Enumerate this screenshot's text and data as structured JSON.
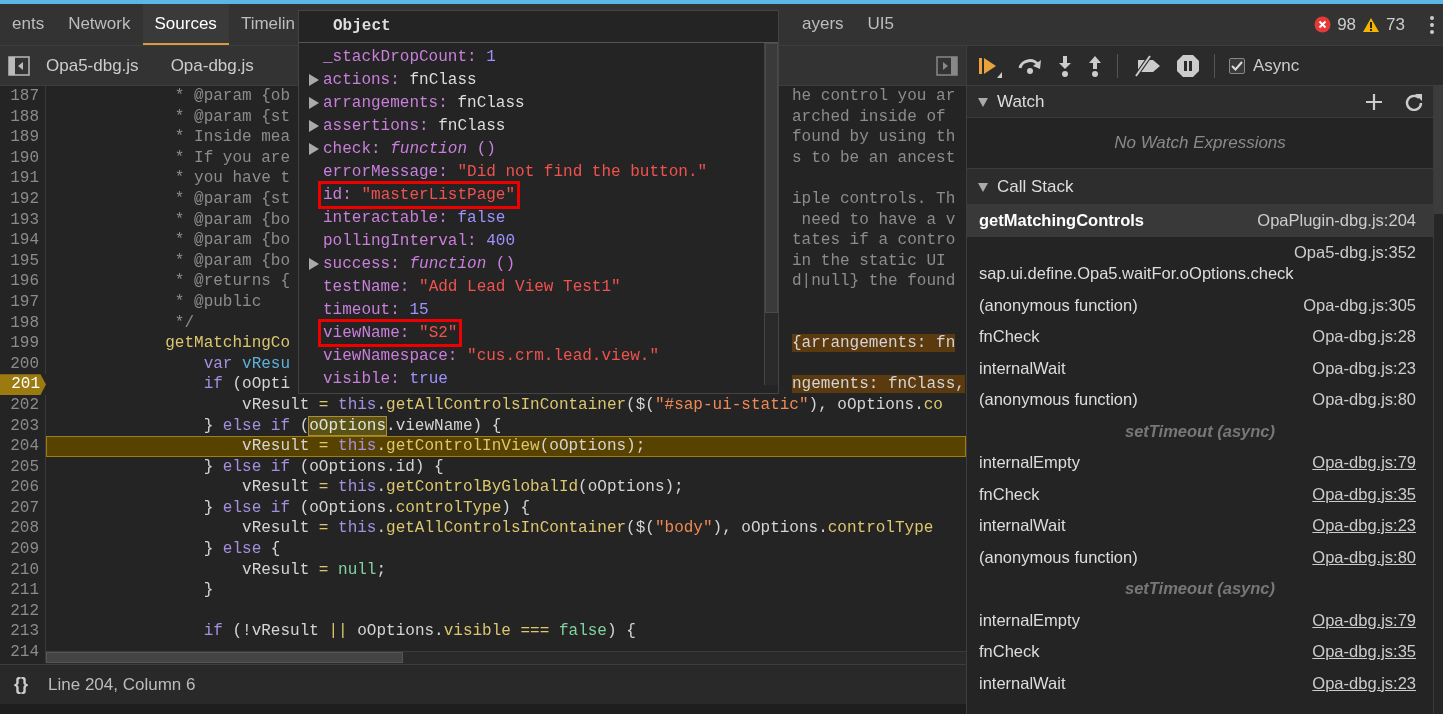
{
  "tabs": [
    {
      "label": "ents",
      "selected": false
    },
    {
      "label": "Network",
      "selected": false
    },
    {
      "label": "Sources",
      "selected": true
    },
    {
      "label": "Timelin",
      "selected": false
    }
  ],
  "tabs_beyond_popover": [
    {
      "label": "ayers",
      "selected": false
    },
    {
      "label": "UI5",
      "selected": false
    }
  ],
  "counters": {
    "errors": "98",
    "warnings": "73"
  },
  "file_tabs": [
    "Opa5-dbg.js",
    "Opa-dbg.js"
  ],
  "editor": {
    "lines": [
      {
        "number": "187",
        "breakpoint": false,
        "current": false,
        "left": [
          {
            "text": "             * @param {ob",
            "kind": "comment"
          }
        ],
        "right": [
          {
            "text": "he control you ar",
            "kind": "comment"
          }
        ]
      },
      {
        "number": "188",
        "breakpoint": false,
        "current": false,
        "left": [
          {
            "text": "             * @param {st",
            "kind": "comment"
          }
        ],
        "right": [
          {
            "text": "arched inside of",
            "kind": "comment"
          }
        ]
      },
      {
        "number": "189",
        "breakpoint": false,
        "current": false,
        "left": [
          {
            "text": "             * Inside mea",
            "kind": "comment"
          }
        ],
        "right": [
          {
            "text": "found by using th",
            "kind": "comment"
          }
        ]
      },
      {
        "number": "190",
        "breakpoint": false,
        "current": false,
        "left": [
          {
            "text": "             * If you are",
            "kind": "comment"
          }
        ],
        "right": [
          {
            "text": "s to be an ancest",
            "kind": "comment"
          }
        ]
      },
      {
        "number": "191",
        "breakpoint": false,
        "current": false,
        "left": [
          {
            "text": "             * you have t",
            "kind": "comment"
          }
        ]
      },
      {
        "number": "192",
        "breakpoint": false,
        "current": false,
        "left": [
          {
            "text": "             * @param {st",
            "kind": "comment"
          }
        ],
        "right": [
          {
            "text": "iple controls. Th",
            "kind": "comment"
          }
        ]
      },
      {
        "number": "193",
        "breakpoint": false,
        "current": false,
        "left": [
          {
            "text": "             * @param {bo",
            "kind": "comment"
          }
        ],
        "right": [
          {
            "text": " need to have a v",
            "kind": "comment"
          }
        ]
      },
      {
        "number": "194",
        "breakpoint": false,
        "current": false,
        "left": [
          {
            "text": "             * @param {bo",
            "kind": "comment"
          }
        ],
        "right": [
          {
            "text": "tates if a contro",
            "kind": "comment"
          }
        ]
      },
      {
        "number": "195",
        "breakpoint": false,
        "current": false,
        "left": [
          {
            "text": "             * @param {bo",
            "kind": "comment"
          }
        ],
        "right": [
          {
            "text": "in the static UI",
            "kind": "comment"
          }
        ]
      },
      {
        "number": "196",
        "breakpoint": false,
        "current": false,
        "left": [
          {
            "text": "             * @returns {",
            "kind": "comment"
          }
        ],
        "right": [
          {
            "text": "d|null} the found",
            "kind": "comment"
          }
        ]
      },
      {
        "number": "197",
        "breakpoint": false,
        "current": false,
        "left": [
          {
            "text": "             * @public",
            "kind": "comment"
          }
        ]
      },
      {
        "number": "198",
        "breakpoint": false,
        "current": false,
        "left": [
          {
            "text": "             */",
            "kind": "comment"
          }
        ]
      },
      {
        "number": "199",
        "breakpoint": false,
        "current": false,
        "left": [
          {
            "text": "            getMatchingCo",
            "kind": "method"
          }
        ],
        "right": [
          {
            "text": "{arrangements: fn",
            "kind": "inline_value"
          }
        ]
      },
      {
        "number": "200",
        "breakpoint": false,
        "current": false,
        "left": [
          {
            "text": "                var ",
            "kind": "keyword"
          },
          {
            "text": "vResu",
            "kind": "variable"
          }
        ]
      },
      {
        "number": "201",
        "breakpoint": true,
        "current": false,
        "left": [
          {
            "text": "                if",
            "kind": "keyword"
          },
          {
            "text": " (oOpti",
            "kind": "plain"
          }
        ],
        "right": [
          {
            "text": "ngements: fnClass,",
            "kind": "inline_value"
          }
        ]
      },
      {
        "number": "202",
        "breakpoint": false,
        "current": false,
        "left": [
          {
            "text": "                    vResult ",
            "kind": "plain"
          },
          {
            "text": "= ",
            "kind": "operator"
          },
          {
            "text": "this",
            "kind": "keyword"
          },
          {
            "text": ".",
            "kind": "plain"
          },
          {
            "text": "getAllControlsInContainer",
            "kind": "method"
          },
          {
            "text": "($(",
            "kind": "plain"
          },
          {
            "text": "\"#sap-ui-static\"",
            "kind": "string"
          },
          {
            "text": "), oOptions.",
            "kind": "plain"
          },
          {
            "text": "co",
            "kind": "method"
          }
        ]
      },
      {
        "number": "203",
        "breakpoint": false,
        "current": false,
        "left": [
          {
            "text": "                } ",
            "kind": "plain"
          },
          {
            "text": "else if",
            "kind": "keyword"
          },
          {
            "text": " (",
            "kind": "plain"
          },
          {
            "text": "oOptions",
            "kind": "hover"
          },
          {
            "text": ".viewName) {",
            "kind": "plain"
          }
        ]
      },
      {
        "number": "204",
        "breakpoint": false,
        "current": true,
        "left": [
          {
            "text": "                    vResult ",
            "kind": "plain"
          },
          {
            "text": "= ",
            "kind": "operator"
          },
          {
            "text": "this",
            "kind": "keyword"
          },
          {
            "text": ".",
            "kind": "plain"
          },
          {
            "text": "getControlInView",
            "kind": "method"
          },
          {
            "text": "(oOptions);",
            "kind": "plain"
          }
        ]
      },
      {
        "number": "205",
        "breakpoint": false,
        "current": false,
        "left": [
          {
            "text": "                } ",
            "kind": "plain"
          },
          {
            "text": "else if",
            "kind": "keyword"
          },
          {
            "text": " (oOptions.id) {",
            "kind": "plain"
          }
        ]
      },
      {
        "number": "206",
        "breakpoint": false,
        "current": false,
        "left": [
          {
            "text": "                    vResult ",
            "kind": "plain"
          },
          {
            "text": "= ",
            "kind": "operator"
          },
          {
            "text": "this",
            "kind": "keyword"
          },
          {
            "text": ".",
            "kind": "plain"
          },
          {
            "text": "getControlByGlobalId",
            "kind": "method"
          },
          {
            "text": "(oOptions);",
            "kind": "plain"
          }
        ]
      },
      {
        "number": "207",
        "breakpoint": false,
        "current": false,
        "left": [
          {
            "text": "                } ",
            "kind": "plain"
          },
          {
            "text": "else if",
            "kind": "keyword"
          },
          {
            "text": " (oOptions.",
            "kind": "plain"
          },
          {
            "text": "controlType",
            "kind": "method"
          },
          {
            "text": ") {",
            "kind": "plain"
          }
        ]
      },
      {
        "number": "208",
        "breakpoint": false,
        "current": false,
        "left": [
          {
            "text": "                    vResult ",
            "kind": "plain"
          },
          {
            "text": "= ",
            "kind": "operator"
          },
          {
            "text": "this",
            "kind": "keyword"
          },
          {
            "text": ".",
            "kind": "plain"
          },
          {
            "text": "getAllControlsInContainer",
            "kind": "method"
          },
          {
            "text": "($(",
            "kind": "plain"
          },
          {
            "text": "\"body\"",
            "kind": "string"
          },
          {
            "text": "), oOptions.",
            "kind": "plain"
          },
          {
            "text": "controlType",
            "kind": "method"
          }
        ]
      },
      {
        "number": "209",
        "breakpoint": false,
        "current": false,
        "left": [
          {
            "text": "                } ",
            "kind": "plain"
          },
          {
            "text": "else",
            "kind": "keyword"
          },
          {
            "text": " {",
            "kind": "plain"
          }
        ]
      },
      {
        "number": "210",
        "breakpoint": false,
        "current": false,
        "left": [
          {
            "text": "                    vResult ",
            "kind": "plain"
          },
          {
            "text": "= ",
            "kind": "operator"
          },
          {
            "text": "null",
            "kind": "literal"
          },
          {
            "text": ";",
            "kind": "plain"
          }
        ]
      },
      {
        "number": "211",
        "breakpoint": false,
        "current": false,
        "left": [
          {
            "text": "                }",
            "kind": "plain"
          }
        ]
      },
      {
        "number": "212",
        "breakpoint": false,
        "current": false
      },
      {
        "number": "213",
        "breakpoint": false,
        "current": false,
        "left": [
          {
            "text": "                if",
            "kind": "keyword"
          },
          {
            "text": " (!vResult ",
            "kind": "plain"
          },
          {
            "text": "|| ",
            "kind": "operator"
          },
          {
            "text": "oOptions.",
            "kind": "plain"
          },
          {
            "text": "visible",
            "kind": "method"
          },
          {
            "text": " === ",
            "kind": "operator"
          },
          {
            "text": "false",
            "kind": "literal"
          },
          {
            "text": ") {",
            "kind": "plain"
          }
        ]
      },
      {
        "number": "214",
        "breakpoint": false,
        "current": false
      }
    ]
  },
  "popover": {
    "title": "Object",
    "properties": [
      {
        "key": "_stackDropCount:",
        "value": "1",
        "kind": "number",
        "expandable": false,
        "marked": false
      },
      {
        "key": "actions:",
        "value": "fnClass",
        "kind": "object",
        "expandable": true,
        "marked": false
      },
      {
        "key": "arrangements:",
        "value": "fnClass",
        "kind": "object",
        "expandable": true,
        "marked": false
      },
      {
        "key": "assertions:",
        "value": "fnClass",
        "kind": "object",
        "expandable": true,
        "marked": false
      },
      {
        "key": "check:",
        "value": "*function* ()",
        "kind": "function",
        "expandable": true,
        "marked": false
      },
      {
        "key": "errorMessage:",
        "value": "\"Did not find the button.\"",
        "kind": "string",
        "expandable": false,
        "marked": false
      },
      {
        "key": "id:",
        "value": "\"masterListPage\"",
        "kind": "string",
        "expandable": false,
        "marked": true
      },
      {
        "key": "interactable:",
        "value": "false",
        "kind": "boolean",
        "expandable": false,
        "marked": false
      },
      {
        "key": "pollingInterval:",
        "value": "400",
        "kind": "number",
        "expandable": false,
        "marked": false
      },
      {
        "key": "success:",
        "value": "*function* ()",
        "kind": "function",
        "expandable": true,
        "marked": false
      },
      {
        "key": "testName:",
        "value": "\"Add Lead View Test1\"",
        "kind": "string",
        "expandable": false,
        "marked": false
      },
      {
        "key": "timeout:",
        "value": "15",
        "kind": "number",
        "expandable": false,
        "marked": false
      },
      {
        "key": "viewName:",
        "value": "\"S2\"",
        "kind": "string",
        "expandable": false,
        "marked": true
      },
      {
        "key": "viewNamespace:",
        "value": "\"cus.crm.lead.view.\"",
        "kind": "string",
        "expandable": false,
        "marked": false
      },
      {
        "key": "visible:",
        "value": "true",
        "kind": "boolean",
        "expandable": false,
        "marked": false
      }
    ]
  },
  "async_checkbox": {
    "label": "Async",
    "checked": true
  },
  "watch": {
    "title": "Watch",
    "expanded": true,
    "empty_text": "No Watch Expressions"
  },
  "call_stack": {
    "title": "Call Stack",
    "expanded": true,
    "frames": [
      {
        "kind": "frame",
        "name": "getMatchingControls",
        "location": "OpaPlugin-dbg.js:204",
        "selected": true,
        "linked": false
      },
      {
        "kind": "frame",
        "name": "sap.ui.define.Opa5.waitFor.oOptions.check",
        "location": "Opa5-dbg.js:352",
        "selected": false,
        "linked": false
      },
      {
        "kind": "frame",
        "name": "(anonymous function)",
        "location": "Opa-dbg.js:305",
        "selected": false,
        "linked": false
      },
      {
        "kind": "frame",
        "name": "fnCheck",
        "location": "Opa-dbg.js:28",
        "selected": false,
        "linked": false
      },
      {
        "kind": "frame",
        "name": "internalWait",
        "location": "Opa-dbg.js:23",
        "selected": false,
        "linked": false
      },
      {
        "kind": "frame",
        "name": "(anonymous function)",
        "location": "Opa-dbg.js:80",
        "selected": false,
        "linked": false
      },
      {
        "kind": "separator",
        "label": "setTimeout (async)"
      },
      {
        "kind": "frame",
        "name": "internalEmpty",
        "location": "Opa-dbg.js:79",
        "selected": false,
        "linked": true
      },
      {
        "kind": "frame",
        "name": "fnCheck",
        "location": "Opa-dbg.js:35",
        "selected": false,
        "linked": true
      },
      {
        "kind": "frame",
        "name": "internalWait",
        "location": "Opa-dbg.js:23",
        "selected": false,
        "linked": true
      },
      {
        "kind": "frame",
        "name": "(anonymous function)",
        "location": "Opa-dbg.js:80",
        "selected": false,
        "linked": true
      },
      {
        "kind": "separator",
        "label": "setTimeout (async)"
      },
      {
        "kind": "frame",
        "name": "internalEmpty",
        "location": "Opa-dbg.js:79",
        "selected": false,
        "linked": true
      },
      {
        "kind": "frame",
        "name": "fnCheck",
        "location": "Opa-dbg.js:35",
        "selected": false,
        "linked": true
      },
      {
        "kind": "frame",
        "name": "internalWait",
        "location": "Opa-dbg.js:23",
        "selected": false,
        "linked": true
      }
    ]
  },
  "status_bar": {
    "pretty_print": "{}",
    "position": "Line 204, Column 6"
  }
}
